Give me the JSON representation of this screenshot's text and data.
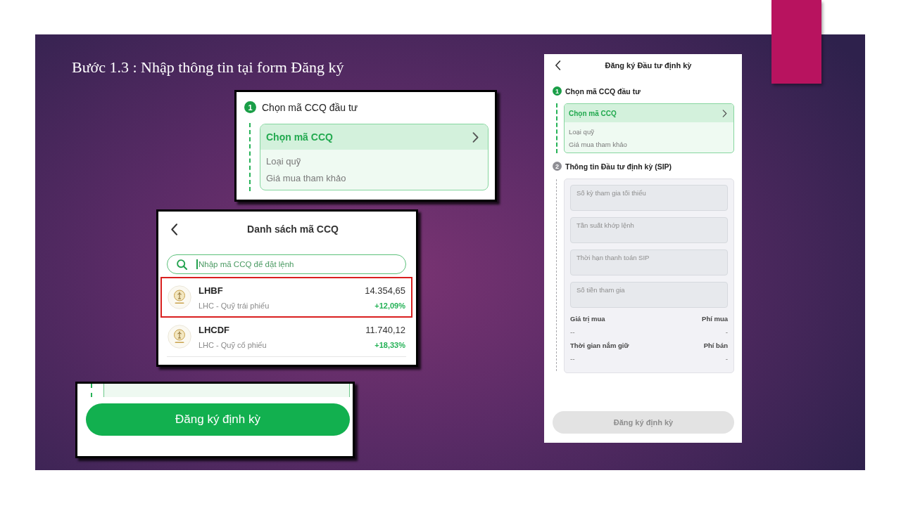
{
  "slide": {
    "title": "Bước 1.3 : Nhập thông tin tại form Đăng ký",
    "step_crop": {
      "number": "1",
      "title": "Chọn mã CCQ đầu tư",
      "active": true,
      "select_label": "Chọn mã CCQ",
      "fields": [
        "Loại quỹ",
        "Giá mua tham khảo"
      ]
    },
    "fund_list": {
      "title": "Danh sách mã CCQ",
      "search": {
        "placeholder": "Nhập mã CCQ để đặt lệnh"
      },
      "items": [
        {
          "code": "LHBF",
          "name": "LHC - Quỹ trái phiếu",
          "price": "14.354,65",
          "change": "+12,09%",
          "highlighted": true
        },
        {
          "code": "LHCDF",
          "name": "LHC - Quỹ cổ phiếu",
          "price": "11.740,12",
          "change": "+18,33%",
          "highlighted": false
        }
      ]
    },
    "button_crop": {
      "label": "Đăng ký định kỳ",
      "disabled": false
    },
    "phone": {
      "title": "Đăng ký Đầu tư định kỳ",
      "steps": [
        {
          "kind": "fund_picker",
          "number": "1",
          "title": "Chọn mã CCQ đầu tư",
          "active": true,
          "select_label": "Chọn mã CCQ",
          "fields": [
            "Loại quỹ",
            "Giá mua tham khảo"
          ]
        },
        {
          "kind": "sip_form",
          "number": "2",
          "title": "Thông tin Đầu tư định kỳ (SIP)",
          "active": false,
          "inputs": [
            {
              "placeholder": "Số kỳ tham gia tối thiểu"
            },
            {
              "placeholder": "Tần suất khớp lệnh"
            },
            {
              "placeholder": "Thời hạn thanh toán SIP"
            },
            {
              "placeholder": "Số tiền tham gia"
            }
          ],
          "summary": [
            {
              "label": "Giá trị mua",
              "value": "--"
            },
            {
              "label": "Phí mua",
              "value": "-"
            },
            {
              "label": "Thời gian nắm giữ",
              "value": "--"
            },
            {
              "label": "Phí bán",
              "value": "-"
            }
          ]
        }
      ],
      "submit_button": {
        "label": "Đăng ký định kỳ",
        "disabled": true
      }
    }
  }
}
